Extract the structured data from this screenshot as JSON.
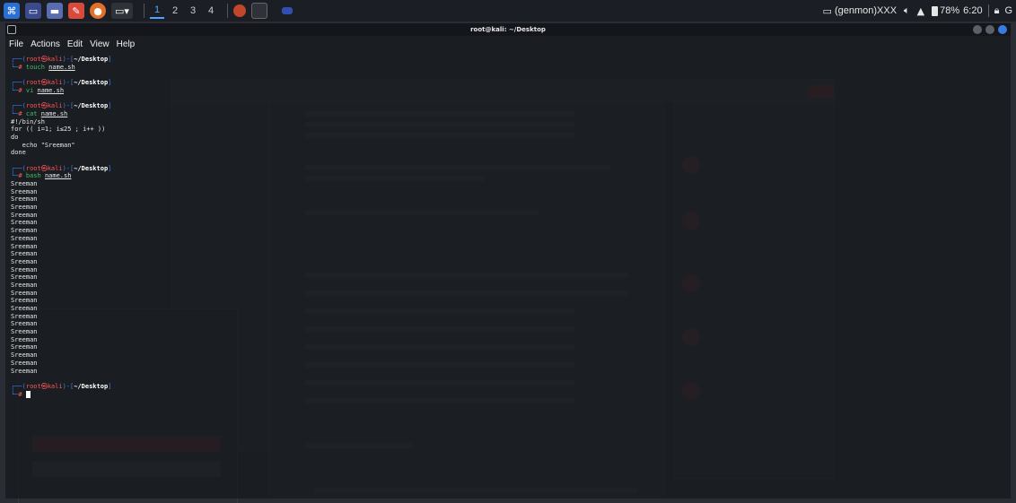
{
  "taskbar": {
    "workspaces": [
      "1",
      "2",
      "3",
      "4"
    ],
    "active_workspace": "1",
    "tray": {
      "genmon": "(genmon)XXX",
      "battery": "78%",
      "time": "6:20",
      "trailing": "G"
    }
  },
  "terminal": {
    "title": "root@kali: ~/Desktop",
    "menu": [
      "File",
      "Actions",
      "Edit",
      "View",
      "Help"
    ],
    "prompt": {
      "user": "root",
      "host": "kali",
      "dir": "~/Desktop",
      "hash": "#"
    },
    "session": [
      {
        "cmd": "touch",
        "arg": "name.sh",
        "output": []
      },
      {
        "cmd": "vi",
        "arg": "name.sh",
        "output": []
      },
      {
        "cmd": "cat",
        "arg": "name.sh",
        "output": [
          "#!/bin/sh",
          "for (( i=1; i≤25 ; i++ ))",
          "do",
          "   echo \"Sreeman\"",
          "done"
        ]
      },
      {
        "cmd": "bash",
        "arg": "name.sh",
        "output": [
          "Sreeman",
          "Sreeman",
          "Sreeman",
          "Sreeman",
          "Sreeman",
          "Sreeman",
          "Sreeman",
          "Sreeman",
          "Sreeman",
          "Sreeman",
          "Sreeman",
          "Sreeman",
          "Sreeman",
          "Sreeman",
          "Sreeman",
          "Sreeman",
          "Sreeman",
          "Sreeman",
          "Sreeman",
          "Sreeman",
          "Sreeman",
          "Sreeman",
          "Sreeman",
          "Sreeman",
          "Sreeman"
        ]
      }
    ]
  },
  "colors": {
    "accent": "#4ea5ff",
    "prompt_frame": "#3d7ee6",
    "prompt_user": "#ff5555",
    "command": "#3fbf5f"
  },
  "icons": [
    "kali-menu-icon",
    "terminal-icon",
    "files-icon",
    "text-editor-icon",
    "firefox-icon",
    "volume-icon",
    "bell-icon",
    "battery-icon",
    "lock-icon"
  ]
}
